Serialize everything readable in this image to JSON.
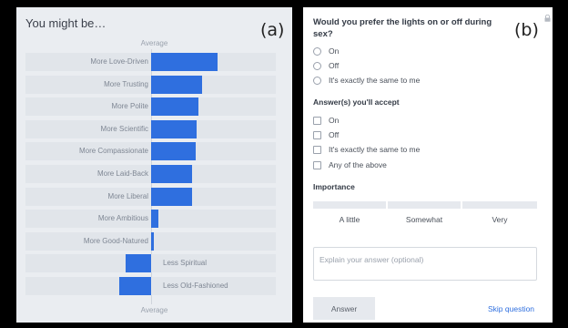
{
  "panel_a": {
    "title": "You might be…",
    "label": "(a)",
    "average_top": "Average",
    "average_bottom": "Average",
    "traits": [
      {
        "label": "More Love-Driven",
        "side": "left",
        "value": 0.52
      },
      {
        "label": "More Trusting",
        "side": "left",
        "value": 0.4
      },
      {
        "label": "More Polite",
        "side": "left",
        "value": 0.37
      },
      {
        "label": "More Scientific",
        "side": "left",
        "value": 0.36
      },
      {
        "label": "More Compassionate",
        "side": "left",
        "value": 0.35
      },
      {
        "label": "More Laid-Back",
        "side": "left",
        "value": 0.32
      },
      {
        "label": "More Liberal",
        "side": "left",
        "value": 0.32
      },
      {
        "label": "More Ambitious",
        "side": "left",
        "value": 0.06
      },
      {
        "label": "More Good-Natured",
        "side": "left",
        "value": 0.02
      },
      {
        "label": "Less Spiritual",
        "side": "right",
        "value": -0.2
      },
      {
        "label": "Less Old-Fashioned",
        "side": "right",
        "value": -0.25
      }
    ]
  },
  "panel_b": {
    "label": "(b)",
    "lock_icon": "lock-icon",
    "question": "Would you prefer the lights on or off during sex?",
    "options": [
      "On",
      "Off",
      "It's exactly the same to me"
    ],
    "accept_heading": "Answer(s) you'll accept",
    "accept_options": [
      "On",
      "Off",
      "It's exactly the same to me",
      "Any of the above"
    ],
    "importance_heading": "Importance",
    "importance_levels": [
      "A little",
      "Somewhat",
      "Very"
    ],
    "explain_placeholder": "Explain your answer (optional)",
    "answer_button": "Answer",
    "skip_link": "Skip question",
    "accent_color": "#2f6fdf"
  }
}
